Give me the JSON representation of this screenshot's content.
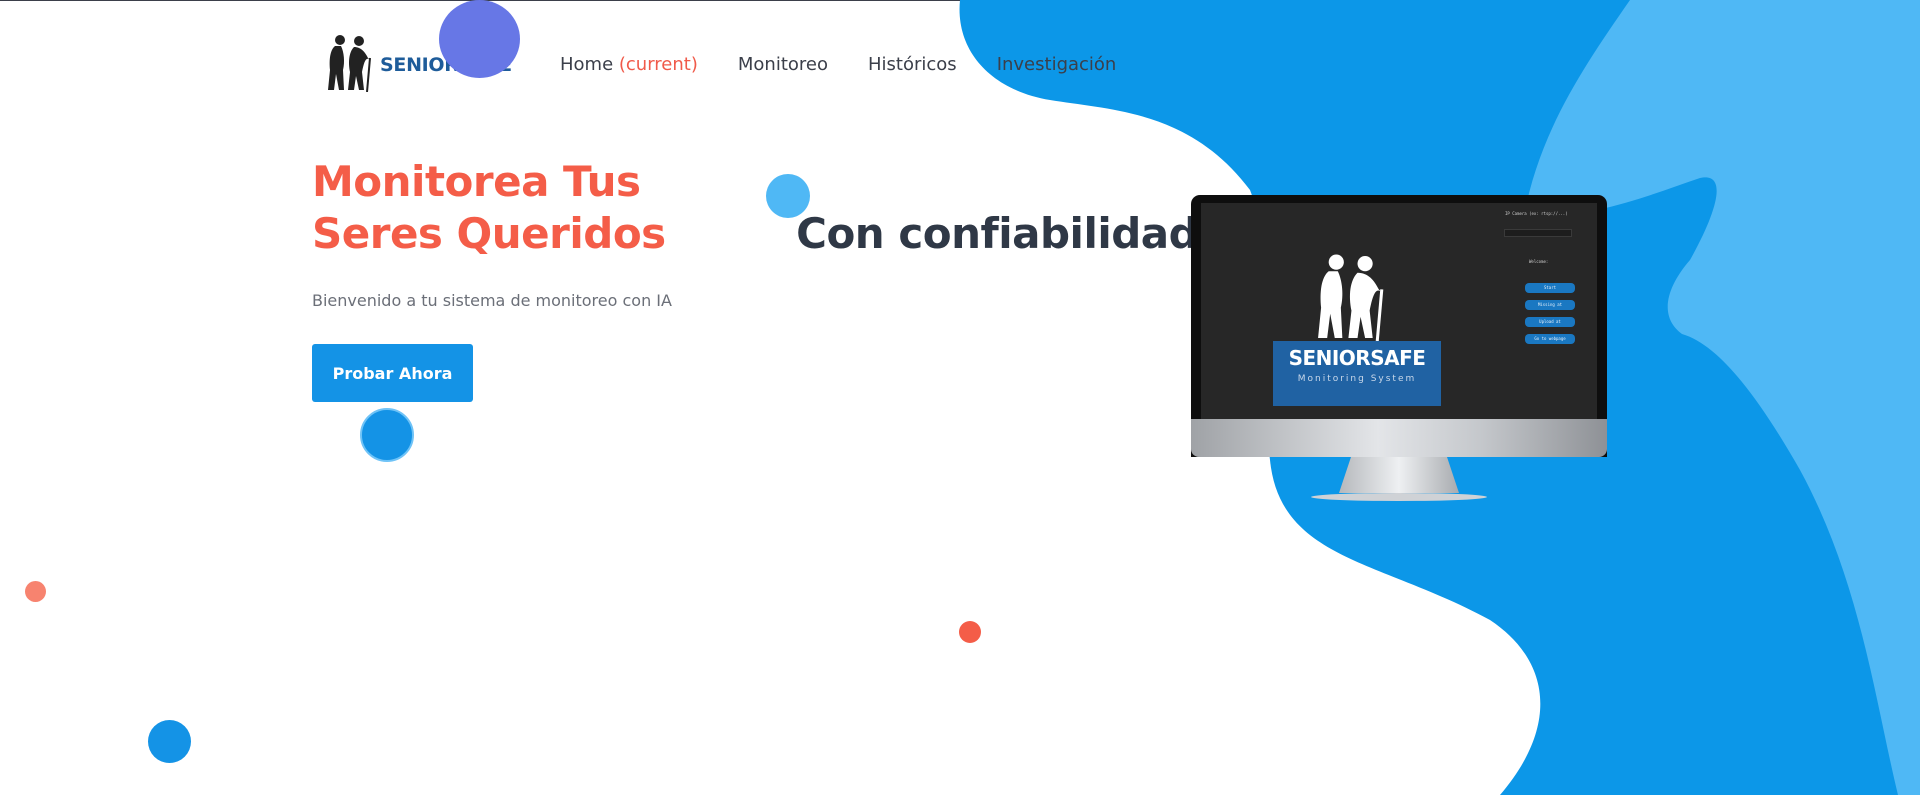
{
  "header": {
    "logo_text": "SENIORSAFE",
    "nav": {
      "home": "Home",
      "home_current": "(current)",
      "monitoreo": "Monitoreo",
      "historicos": "Históricos",
      "investigacion": "Investigación"
    }
  },
  "hero": {
    "title_accent": "Monitorea Tus Seres Queridos",
    "title_dark": "Con confiabilidad",
    "subtitle": "Bienvenido a tu sistema de monitoreo con IA",
    "cta_label": "Probar Ahora"
  },
  "monitor_screen": {
    "brand_name": "SENIORSAFE",
    "brand_tag": "Monitoring System",
    "panel_title": "IP Camera (ex: rtsp://...)",
    "panel_label": "Welcome:",
    "buttons": [
      "Start",
      "Missing at",
      "Upload at",
      "Go to webpage"
    ]
  },
  "colors": {
    "accent_red": "#f45d48",
    "primary_blue": "#1493e6",
    "light_blue": "#4fb8f5",
    "title_dark": "#2f3846",
    "logo_blue": "#1e5c9a"
  },
  "icons": [
    "elderly-couple-icon"
  ]
}
